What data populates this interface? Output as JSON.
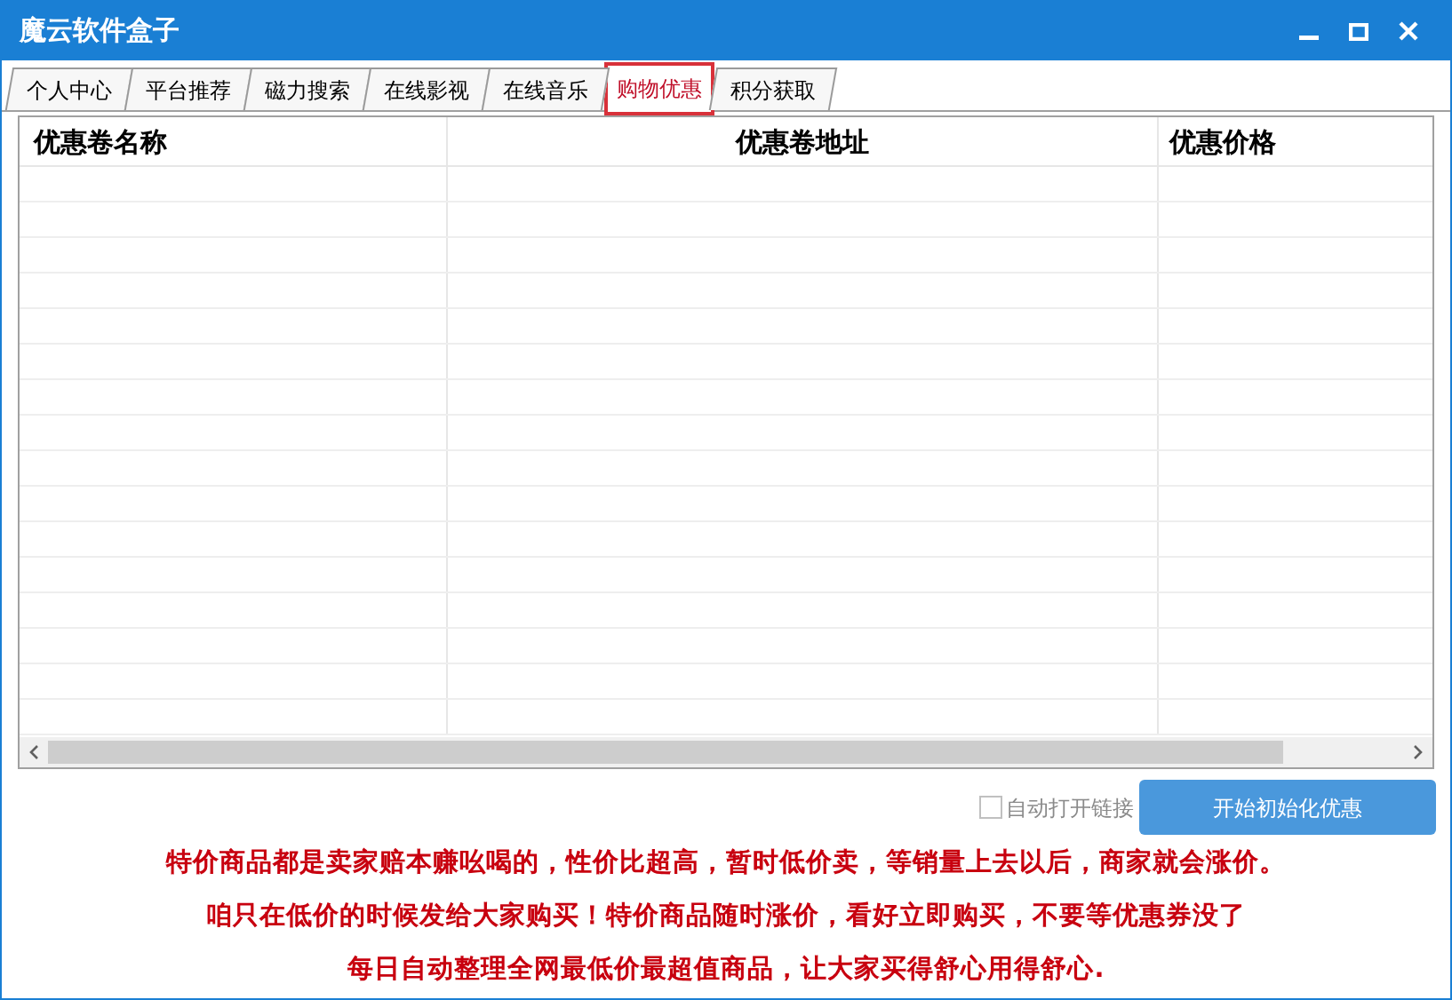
{
  "window": {
    "title": "魔云软件盒子"
  },
  "tabs": [
    {
      "label": "个人中心",
      "selected": false
    },
    {
      "label": "平台推荐",
      "selected": false
    },
    {
      "label": "磁力搜索",
      "selected": false
    },
    {
      "label": "在线影视",
      "selected": false
    },
    {
      "label": "在线音乐",
      "selected": false
    },
    {
      "label": "购物优惠",
      "selected": true
    },
    {
      "label": "积分获取",
      "selected": false
    }
  ],
  "table": {
    "columns": [
      "优惠卷名称",
      "优惠卷地址",
      "优惠价格"
    ]
  },
  "options": {
    "auto_open_link": {
      "label": "自动打开链接",
      "checked": false,
      "disabled": true
    }
  },
  "start_button": "开始初始化优惠",
  "notice_lines": [
    "特价商品都是卖家赔本赚吆喝的，性价比超高，暂时低价卖，等销量上去以后，商家就会涨价。",
    "咱只在低价的时候发给大家购买！特价商品随时涨价，看好立即购买，不要等优惠券没了",
    "每日自动整理全网最低价最超值商品，让大家买得舒心用得舒心."
  ]
}
